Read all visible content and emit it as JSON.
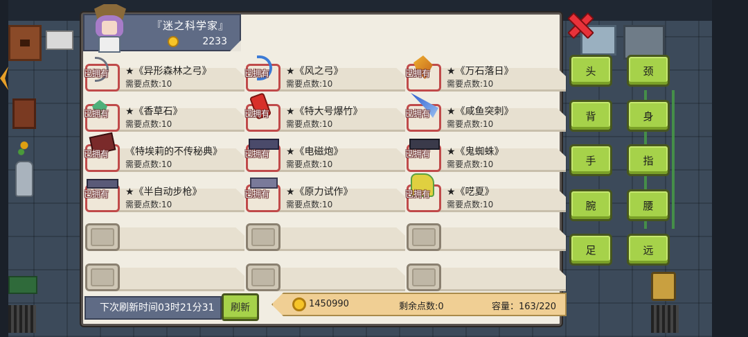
{
  "header": {
    "title": "『迷之科学家』",
    "coins": "2233"
  },
  "owned_label": "已拥有",
  "slots": [
    {
      "name": "★《异形森林之弓》",
      "cost": "需要点数:10",
      "owned": true,
      "icon": "bow-icon"
    },
    {
      "name": "★《风之弓》",
      "cost": "需要点数:10",
      "owned": true,
      "icon": "wind-bow-icon"
    },
    {
      "name": "★《万石落日》",
      "cost": "需要点数:10",
      "owned": true,
      "icon": "sunset-weapon-icon"
    },
    {
      "name": "★《香草石》",
      "cost": "需要点数:10",
      "owned": true,
      "icon": "gem-icon"
    },
    {
      "name": "★《特大号爆竹》",
      "cost": "需要点数:10",
      "owned": true,
      "icon": "firecracker-icon"
    },
    {
      "name": "★《咸鱼突刺》",
      "cost": "需要点数:10",
      "owned": true,
      "icon": "fish-spear-icon"
    },
    {
      "name": "《特埃莉的不传秘典》",
      "cost": "需要点数:10",
      "owned": true,
      "icon": "spellbook-icon"
    },
    {
      "name": "★《电磁炮》",
      "cost": "需要点数:10",
      "owned": true,
      "icon": "railgun-icon"
    },
    {
      "name": "★《鬼蜘蛛》",
      "cost": "需要点数:10",
      "owned": true,
      "icon": "spider-gun-icon"
    },
    {
      "name": "★《半自动步枪》",
      "cost": "需要点数:10",
      "owned": true,
      "icon": "rifle-icon"
    },
    {
      "name": "★《原力试作》",
      "cost": "需要点数:10",
      "owned": true,
      "icon": "force-gun-icon"
    },
    {
      "name": "★《呓夏》",
      "cost": "需要点数:10",
      "owned": true,
      "icon": "summer-gun-icon"
    },
    {
      "name": "",
      "cost": "",
      "owned": false,
      "icon": "empty-slot"
    },
    {
      "name": "",
      "cost": "",
      "owned": false,
      "icon": "empty-slot"
    },
    {
      "name": "",
      "cost": "",
      "owned": false,
      "icon": "empty-slot"
    },
    {
      "name": "",
      "cost": "",
      "owned": false,
      "icon": "empty-slot"
    },
    {
      "name": "",
      "cost": "",
      "owned": false,
      "icon": "empty-slot"
    },
    {
      "name": "",
      "cost": "",
      "owned": false,
      "icon": "empty-slot"
    }
  ],
  "footer": {
    "refresh_timer": "下次刷新时间03时21分31",
    "refresh_label": "刷新",
    "coins": "1450990",
    "remaining_points": "剩余点数:0",
    "capacity": "容量：163/220"
  },
  "categories": [
    {
      "id": "head",
      "label": "头"
    },
    {
      "id": "neck",
      "label": "颈"
    },
    {
      "id": "back",
      "label": "背"
    },
    {
      "id": "body",
      "label": "身"
    },
    {
      "id": "hand",
      "label": "手"
    },
    {
      "id": "finger",
      "label": "指"
    },
    {
      "id": "wrist",
      "label": "腕"
    },
    {
      "id": "waist",
      "label": "腰"
    },
    {
      "id": "foot",
      "label": "足"
    },
    {
      "id": "ranged",
      "label": "远"
    }
  ],
  "colors": {
    "panel": "#f1ede2",
    "accent_green": "#a6d24a",
    "header_blue": "#5f6b85",
    "close_red": "#e8323a",
    "coin_gold": "#f6c428"
  }
}
